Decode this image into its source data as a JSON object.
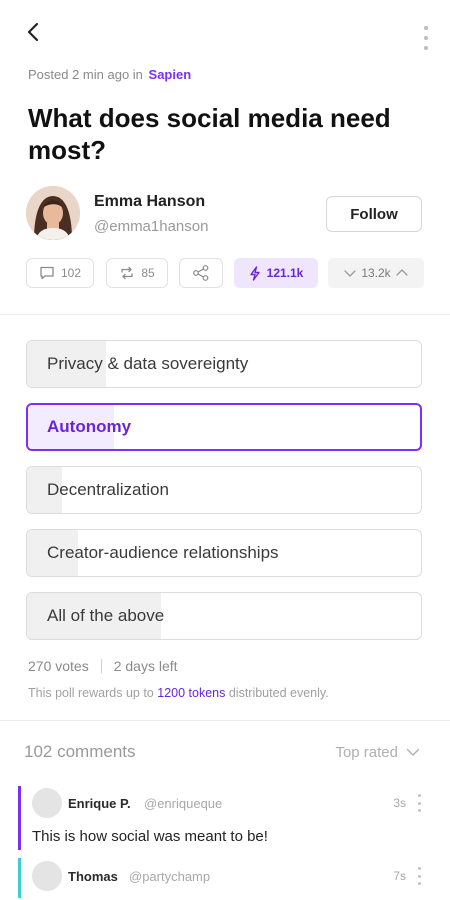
{
  "icons": {
    "back": "chevron-left-icon",
    "more": "vertical-dots-icon",
    "comments": "speech-bubble-icon",
    "reposts": "repost-arrows-icon",
    "share": "share-nodes-icon",
    "boost": "lightning-icon",
    "downvote": "chevron-down-icon",
    "upvote": "chevron-up-icon",
    "sort": "chevron-down-icon"
  },
  "colors": {
    "accent": "#7b2ff7",
    "accent_bg": "#efe6fd",
    "teal": "#3ccfcf"
  },
  "post": {
    "posted_prefix": "Posted 2 min ago in",
    "community": "Sapien",
    "title": "What does social media need most?"
  },
  "author": {
    "name": "Emma Hanson",
    "handle": "@emma1hanson",
    "follow_label": "Follow"
  },
  "actions": {
    "comments": "102",
    "reposts": "85",
    "boost": "121.1k",
    "votes": "13.2k"
  },
  "poll": {
    "options": [
      {
        "label": "Privacy & data sovereignty",
        "fill": 0.2,
        "selected": false
      },
      {
        "label": "Autonomy",
        "fill": 0.22,
        "selected": true
      },
      {
        "label": "Decentralization",
        "fill": 0.09,
        "selected": false
      },
      {
        "label": "Creator-audience relationships",
        "fill": 0.13,
        "selected": false
      },
      {
        "label": "All of the above",
        "fill": 0.34,
        "selected": false
      }
    ],
    "votes": "270 votes",
    "time_left": "2 days left",
    "reward_prefix": "This poll rewards up to",
    "reward_tokens": "1200 tokens",
    "reward_suffix": "distributed evenly."
  },
  "comments": {
    "count_label": "102 comments",
    "sort_label": "Top rated",
    "items": [
      {
        "name": "Enrique P.",
        "handle": "@enriqueque",
        "time": "3s",
        "text": "This is how social was meant to be!",
        "bar_color": "#7b2ff7"
      },
      {
        "name": "Thomas",
        "handle": "@partychamp",
        "time": "7s",
        "text": "",
        "bar_color": "#3ccfcf"
      }
    ]
  }
}
